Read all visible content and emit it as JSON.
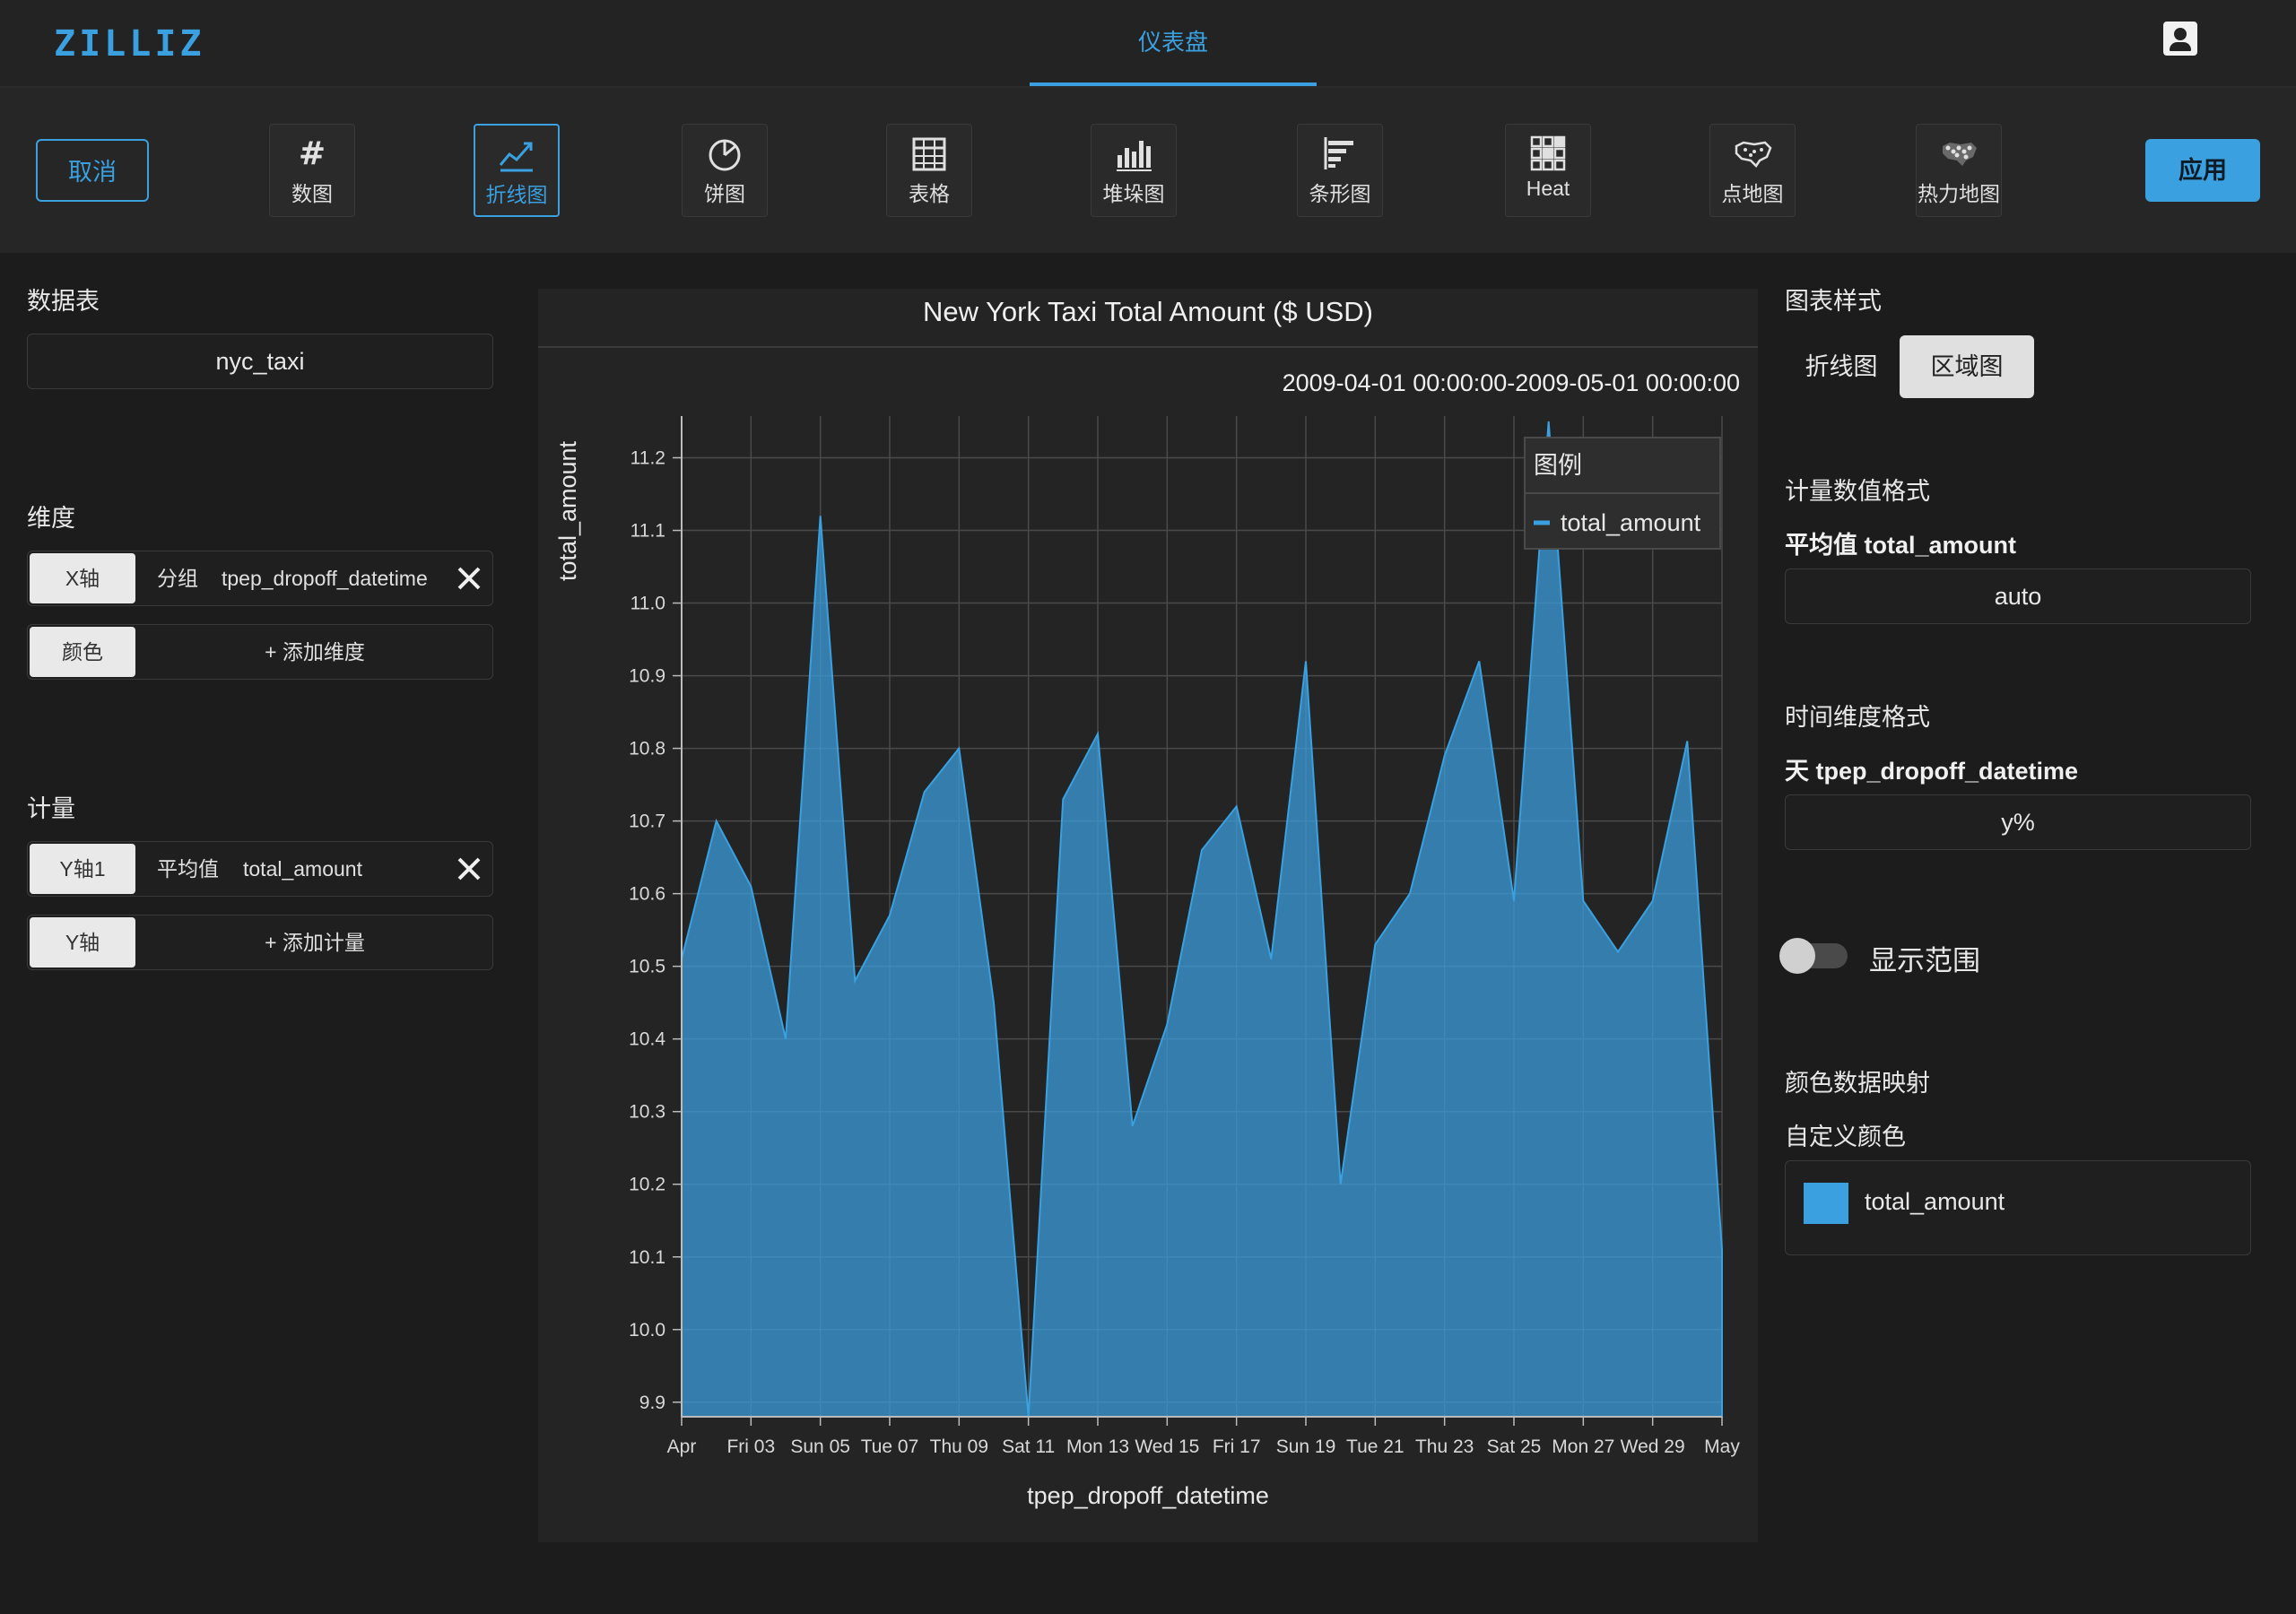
{
  "app": {
    "logo": "ZILLIZ",
    "nav_tab": "仪表盘",
    "user_icon": "user-icon"
  },
  "toolbar": {
    "cancel_label": "取消",
    "apply_label": "应用",
    "chart_types": [
      {
        "label": "数图",
        "icon": "hash-icon",
        "active": false
      },
      {
        "label": "折线图",
        "icon": "line-chart-icon",
        "active": true
      },
      {
        "label": "饼图",
        "icon": "pie-chart-icon",
        "active": false
      },
      {
        "label": "表格",
        "icon": "table-icon",
        "active": false
      },
      {
        "label": "堆垛图",
        "icon": "stacked-bar-icon",
        "active": false
      },
      {
        "label": "条形图",
        "icon": "bar-chart-icon",
        "active": false
      },
      {
        "label": "Heat",
        "icon": "heat-grid-icon",
        "active": false
      },
      {
        "label": "点地图",
        "icon": "point-map-icon",
        "active": false
      },
      {
        "label": "热力地图",
        "icon": "heat-map-icon",
        "active": false
      }
    ]
  },
  "left": {
    "table_title": "数据表",
    "table_value": "nyc_taxi",
    "dimension_title": "维度",
    "x_axis_tag": "X轴",
    "x_group_label": "分组",
    "x_field": "tpep_dropoff_datetime",
    "color_tag": "颜色",
    "add_dimension": "+ 添加维度",
    "measure_title": "计量",
    "y1_tag": "Y轴1",
    "y1_agg": "平均值",
    "y1_field": "total_amount",
    "y_tag": "Y轴",
    "add_measure": "+ 添加计量"
  },
  "right": {
    "style_title": "图表样式",
    "style_line": "折线图",
    "style_area": "区域图",
    "measure_format_title": "计量数值格式",
    "measure_format_field": "平均值 total_amount",
    "measure_format_value": "auto",
    "time_format_title": "时间维度格式",
    "time_format_field": "天 tpep_dropoff_datetime",
    "time_format_value": "y%",
    "show_range_label": "显示范围",
    "show_range_on": false,
    "color_map_title": "颜色数据映射",
    "custom_color_title": "自定义颜色",
    "color_item_label": "total_amount",
    "color_item_hex": "#3aa0e0"
  },
  "chart_data": {
    "type": "area",
    "title": "New York Taxi Total Amount ($ USD)",
    "range_label": "2009-04-01 00:00:00-2009-05-01 00:00:00",
    "xlabel": "tpep_dropoff_datetime",
    "ylabel": "total_amount",
    "ylim": [
      9.88,
      11.25
    ],
    "y_ticks": [
      "9.9",
      "10.0",
      "10.1",
      "10.2",
      "10.3",
      "10.4",
      "10.5",
      "10.6",
      "10.7",
      "10.8",
      "10.9",
      "11.0",
      "11.1",
      "11.2"
    ],
    "x_tick_labels": [
      "Apr",
      "Fri 03",
      "Sun 05",
      "Tue 07",
      "Thu 09",
      "Sat 11",
      "Mon 13",
      "Wed 15",
      "Fri 17",
      "Sun 19",
      "Tue 21",
      "Thu 23",
      "Sat 25",
      "Mon 27",
      "Wed 29",
      "May"
    ],
    "legend_title": "图例",
    "legend_placement": "top-right",
    "grid": true,
    "series": [
      {
        "name": "total_amount",
        "color": "#3aa0e0",
        "x": [
          "2009-04-01",
          "2009-04-02",
          "2009-04-03",
          "2009-04-04",
          "2009-04-05",
          "2009-04-06",
          "2009-04-07",
          "2009-04-08",
          "2009-04-09",
          "2009-04-10",
          "2009-04-11",
          "2009-04-12",
          "2009-04-13",
          "2009-04-14",
          "2009-04-15",
          "2009-04-16",
          "2009-04-17",
          "2009-04-18",
          "2009-04-19",
          "2009-04-20",
          "2009-04-21",
          "2009-04-22",
          "2009-04-23",
          "2009-04-24",
          "2009-04-25",
          "2009-04-26",
          "2009-04-27",
          "2009-04-28",
          "2009-04-29",
          "2009-04-30",
          "2009-05-01"
        ],
        "values": [
          10.51,
          10.7,
          10.61,
          10.4,
          11.12,
          10.48,
          10.57,
          10.74,
          10.8,
          10.45,
          9.88,
          10.73,
          10.82,
          10.28,
          10.42,
          10.66,
          10.72,
          10.51,
          10.92,
          10.2,
          10.53,
          10.6,
          10.79,
          10.92,
          10.59,
          11.25,
          10.59,
          10.52,
          10.59,
          10.81,
          10.11
        ]
      }
    ]
  }
}
